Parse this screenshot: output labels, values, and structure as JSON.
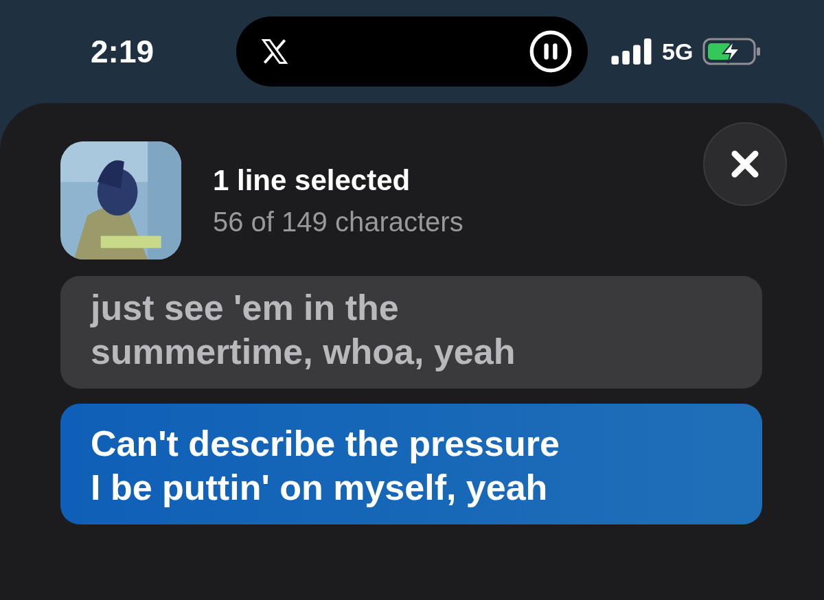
{
  "status_bar": {
    "time": "2:19",
    "network": "5G"
  },
  "header": {
    "title": "1 line selected",
    "subtitle": "56 of 149 characters"
  },
  "lyrics": [
    {
      "lines": [
        "just see 'em in the",
        "summertime, whoa, yeah"
      ],
      "selected": false
    },
    {
      "lines": [
        "Can't describe the pressure",
        "I be puttin' on myself, yeah"
      ],
      "selected": true
    }
  ]
}
